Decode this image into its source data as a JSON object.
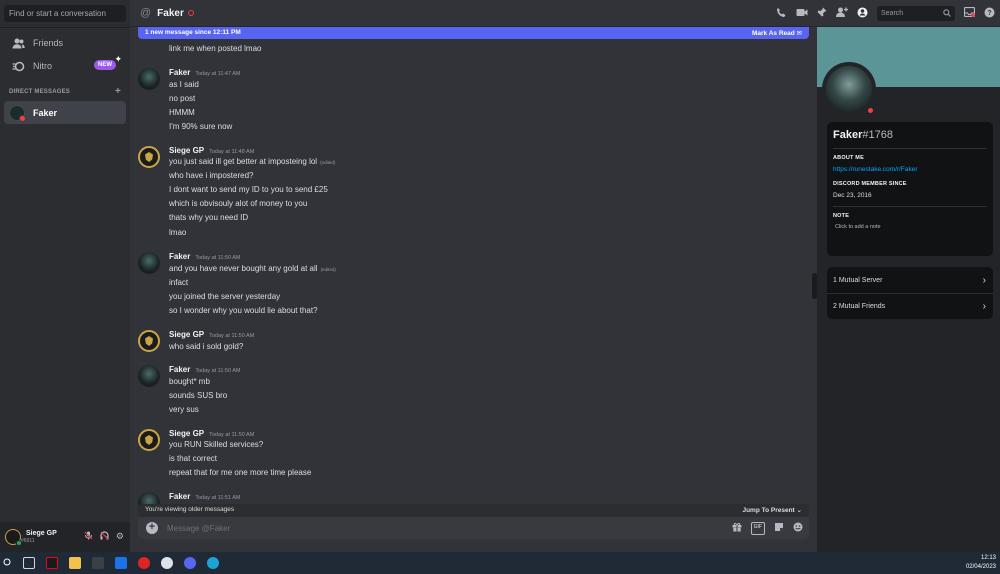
{
  "sidebar": {
    "search_placeholder": "Find or start a conversation",
    "friends_label": "Friends",
    "nitro_label": "Nitro",
    "new_badge": "NEW",
    "dm_header": "DIRECT MESSAGES",
    "dm_item": "Faker",
    "user": {
      "name": "Siege GP",
      "tag": "#6911"
    }
  },
  "topbar": {
    "channel_name": "Faker",
    "search_placeholder": "Search"
  },
  "chat": {
    "new_bar_text": "1 new message since 12:11 PM",
    "mark_as_read": "Mark As Read",
    "groups": [
      {
        "author": "",
        "time": "",
        "lines": [
          "link me when posted lmao"
        ]
      },
      {
        "author": "Faker",
        "time": "Today at 11:47 AM",
        "lines": [
          "as I said",
          "no post",
          "HMMM",
          "I'm 90% sure now"
        ]
      },
      {
        "author": "Siege GP",
        "time": "Today at 11:48 AM",
        "lines": [
          "you just said ill get better at imposteing lol",
          "who have i impostered?",
          "I dont want to send my ID to you to send £25",
          "which is obvisouly alot of money to you",
          "thats why you need ID",
          "lmao"
        ]
      },
      {
        "author": "Faker",
        "time": "Today at 11:50 AM",
        "lines": [
          "and you have never bought any gold at all",
          "infact",
          "you joined the server yesterday",
          "so I wonder why you would lie about that?"
        ]
      },
      {
        "author": "Siege GP",
        "time": "Today at 11:50 AM",
        "lines": [
          "who said i sold gold?"
        ]
      },
      {
        "author": "Faker",
        "time": "Today at 11:50 AM",
        "lines": [
          "bought* mb",
          "sounds SUS bro",
          "very sus"
        ]
      },
      {
        "author": "Siege GP",
        "time": "Today at 11:50 AM",
        "lines": [
          "you RUN Skilled services?",
          "is that correct",
          "repeat that for me one more time please"
        ]
      },
      {
        "author": "Faker",
        "time": "Today at 11:51 AM",
        "lines": []
      }
    ],
    "edited_label": "(edited)",
    "older_text": "You're viewing older messages",
    "jump_label": "Jump To Present",
    "composer_placeholder": "Message @Faker",
    "gif_label": "GIF"
  },
  "profile": {
    "name": "Faker",
    "discriminator": "#1768",
    "about_label": "ABOUT ME",
    "about_link": "https://runestake.com/r/Faker",
    "member_since_label": "DISCORD MEMBER SINCE",
    "member_since": "Dec 23, 2016",
    "note_label": "NOTE",
    "note_placeholder": "Click to add a note",
    "mutual_servers": "1 Mutual Server",
    "mutual_friends": "2 Mutual Friends"
  },
  "taskbar": {
    "time": "12:13",
    "date": "02/04/2023"
  },
  "colors": {
    "accent": "#5865f2",
    "dnd": "#f23f43",
    "online": "#23a55a",
    "banner": "#5b9598",
    "link": "#00a8fc"
  }
}
